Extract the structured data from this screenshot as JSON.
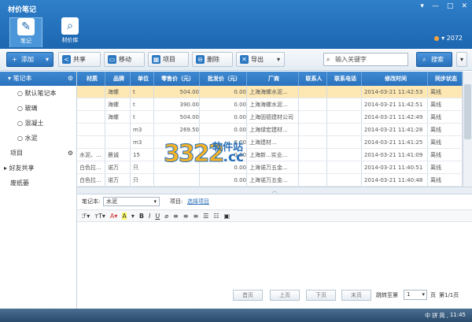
{
  "app": {
    "title": "材价笔记",
    "user": "2072"
  },
  "window_controls": [
    "▾",
    "—",
    "□",
    "✕"
  ],
  "nav_tabs": [
    {
      "label": "笔记",
      "icon": "note-pen-icon"
    },
    {
      "label": "材价库",
      "icon": "library-search-icon"
    }
  ],
  "toolbar": {
    "add": "添加",
    "share": "共享",
    "move": "移动",
    "project": "项目",
    "delete": "删除",
    "export": "导出",
    "search_placeholder": "输入关键字",
    "search": "搜索"
  },
  "sidebar": {
    "header": "笔记本",
    "items": [
      "默认笔记本",
      "玻璃",
      "混凝土",
      "水泥"
    ],
    "sections": [
      "项目",
      "好友共享",
      "废纸篓"
    ]
  },
  "grid": {
    "columns": [
      "材质",
      "品牌",
      "单位",
      "零售价（元）",
      "批发价（元）",
      "厂商",
      "联系人",
      "联系电话",
      "修改时间",
      "同步状态"
    ],
    "rows": [
      [
        "",
        "海螺",
        "t",
        "504.00",
        "0.00",
        "上海海螺水泥...",
        "",
        "",
        "2014-03-21 11:42:53",
        "离线"
      ],
      [
        "",
        "海螺",
        "t",
        "390.00",
        "0.00",
        "上海海螺水泥...",
        "",
        "",
        "2014-03-21 11:42:51",
        "离线"
      ],
      [
        "",
        "海螺",
        "t",
        "504.00",
        "0.00",
        "上海固德建材公司",
        "",
        "",
        "2014-03-21 11:42:49",
        "离线"
      ],
      [
        "",
        "",
        "m3",
        "269.50",
        "0.00",
        "上海绿宏建材...",
        "",
        "",
        "2014-03-21 11:41:28",
        "离线"
      ],
      [
        "",
        "",
        "m3",
        "",
        "0.00",
        "上海建材...",
        "",
        "",
        "2014-03-21 11:41:25",
        "离线"
      ],
      [
        "水泥、...",
        "晨诚",
        "15",
        "",
        "0.00",
        "上海新...实业...",
        "",
        "",
        "2014-03-21 11:41:09",
        "离线"
      ],
      [
        "白色拉...",
        "诺万",
        "只",
        "",
        "0.00",
        "上海诺万五金...",
        "",
        "",
        "2014-03-21 11:40:51",
        "离线"
      ],
      [
        "白色拉...",
        "诺万",
        "只",
        "",
        "0.00",
        "上海诺万五金...",
        "",
        "",
        "2014-03-21 11:40:48",
        "离线"
      ]
    ]
  },
  "editor": {
    "notebook_label": "笔记本:",
    "notebook_value": "水泥",
    "project_label": "项目:",
    "project_link": "选择项目"
  },
  "pager": {
    "first": "首页",
    "prev": "上页",
    "next": "下页",
    "last": "末页",
    "jump": "跳转至第",
    "page_value": "1",
    "page_unit": "页",
    "summary": "第1/1页"
  },
  "watermark": {
    "number": "3322",
    "cn": "软件站",
    "domain": ".cc"
  },
  "taskbar": {
    "tray": "中 拼 简 ,",
    "time": "11:45"
  }
}
